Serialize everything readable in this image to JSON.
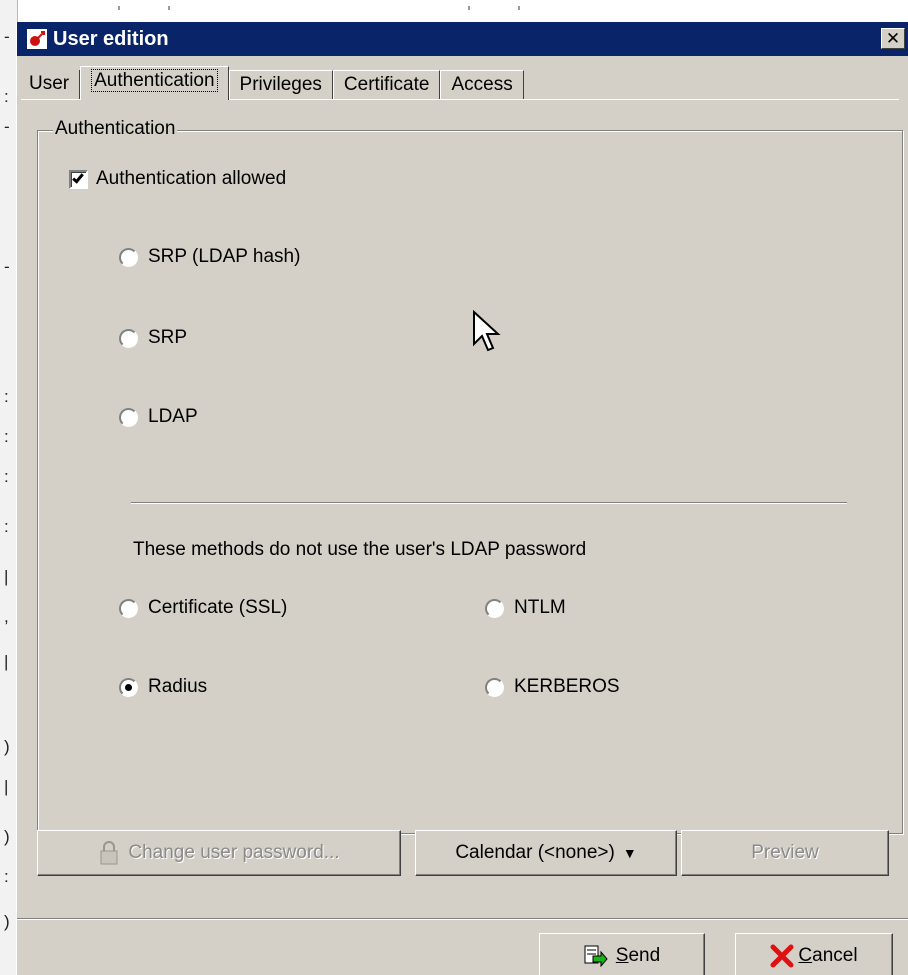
{
  "window": {
    "title": "User edition",
    "close_label": "✕"
  },
  "tabs": [
    {
      "label": "User"
    },
    {
      "label": "Authentication"
    },
    {
      "label": "Privileges"
    },
    {
      "label": "Certificate"
    },
    {
      "label": "Access"
    }
  ],
  "active_tab": "Authentication",
  "auth": {
    "group_title": "Authentication",
    "allowed_label": "Authentication allowed",
    "allowed_checked": true,
    "methods": [
      {
        "label": "SRP (LDAP hash)",
        "selected": false
      },
      {
        "label": "SRP",
        "selected": false
      },
      {
        "label": "LDAP",
        "selected": false
      }
    ],
    "note": "These methods do not use the user's  LDAP password",
    "other_methods": [
      {
        "label": "Certificate (SSL)",
        "selected": false
      },
      {
        "label": "NTLM",
        "selected": false
      },
      {
        "label": "Radius",
        "selected": true
      },
      {
        "label": "KERBEROS",
        "selected": false
      }
    ]
  },
  "actions": {
    "change_password": "Change user password...",
    "calendar": "Calendar (<none>)",
    "preview": "Preview",
    "send_prefix": "",
    "send_mnemonic": "S",
    "send_rest": "end",
    "cancel_mnemonic": "C",
    "cancel_rest": "ancel"
  },
  "colors": {
    "titlebar": "#0a246a",
    "face": "#d4d0c8",
    "cancel_x": "#e01010",
    "send_arrow": "#18b418"
  }
}
